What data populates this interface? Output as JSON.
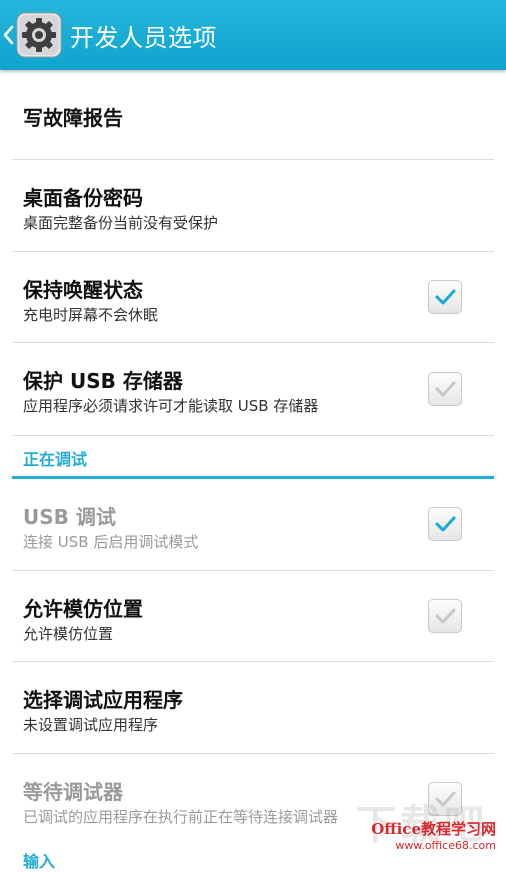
{
  "header": {
    "title": "开发人员选项",
    "background": "#1aa9d4"
  },
  "items": {
    "bugreport": {
      "title": "写故障报告"
    },
    "backup_password": {
      "title": "桌面备份密码",
      "summary": "桌面完整备份当前没有受保护"
    },
    "stay_awake": {
      "title": "保持唤醒状态",
      "summary": "充电时屏幕不会休眠",
      "checked": true
    },
    "protect_usb": {
      "title": "保护 USB 存储器",
      "summary": "应用程序必须请求许可才能读取 USB 存储器",
      "checked": false
    },
    "usb_debugging": {
      "title": "USB 调试",
      "summary": "连接 USB 后启用调试模式",
      "checked": true,
      "enabled": false
    },
    "mock_location": {
      "title": "允许模仿位置",
      "summary": "允许模仿位置",
      "checked": false
    },
    "debug_app": {
      "title": "选择调试应用程序",
      "summary": "未设置调试应用程序"
    },
    "wait_debugger": {
      "title": "等待调试器",
      "summary": "已调试的应用程序在执行前正在等待连接调试器",
      "checked": false,
      "enabled": false
    }
  },
  "sections": {
    "debugging": "正在调试",
    "input": "输入"
  },
  "watermark": {
    "brand": "Office教程学习网",
    "url": "www.office68.com",
    "overlay": "下载吧"
  },
  "colors": {
    "accent": "#23acd6",
    "check_active": "#19a9d8",
    "check_inactive": "#c8c8c8"
  }
}
